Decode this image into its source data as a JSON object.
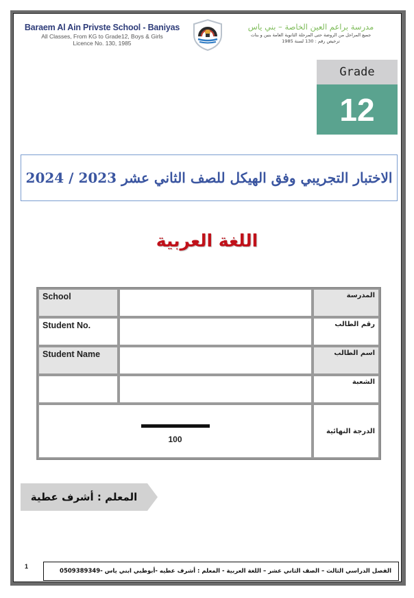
{
  "header": {
    "english": {
      "school_name": "Baraem Al Ain Privste School - Baniyas",
      "classes": "All Classes, From KG to Grade12, Boys & Girls",
      "licence": "Licence No. 130, 1985"
    },
    "arabic": {
      "school_name": "مدرسة براعم العين الخاصة – بني ياس",
      "classes": "جميع المراحل من الروضة حتى المرحلة الثانوية العامة بنين و بنات",
      "licence": "ترخيص رقم : 130 لسنة 1985"
    },
    "logo_icon": "school-shield-logo-icon"
  },
  "grade": {
    "label": "Grade",
    "value": "12"
  },
  "exam_title": "الاختبار التجريبي وفق الهيكل للصف الثاني عشر 2023 / 2024",
  "subject": "اللغة العربية",
  "info_table": {
    "rows": [
      {
        "en": "School",
        "value": "",
        "ar": "المدرسة"
      },
      {
        "en": "Student No.",
        "value": "",
        "ar": "رقم الطالب"
      },
      {
        "en": "Student Name",
        "value": "",
        "ar": "اسم الطالب"
      },
      {
        "en": "",
        "value": "",
        "ar": "الشعبة"
      }
    ],
    "final_grade": {
      "ar": "الدرجة النهائية",
      "score": "",
      "max": "100"
    }
  },
  "teacher_label": "المعلم : أشرف عطية",
  "footer": {
    "page_number": "1",
    "text": "الفصل الدراسي الثالث – الصف الثاني عشر – اللغة العربية - المعلم : أشرف عطيه -أبوظبي ابني ياس -0509389349"
  },
  "colors": {
    "grade_accent": "#5aa38f",
    "title_blue": "#3a55a0",
    "subject_red": "#c0111a",
    "arabic_header_green": "#7dbb58",
    "english_header_navy": "#2f3d7a"
  }
}
